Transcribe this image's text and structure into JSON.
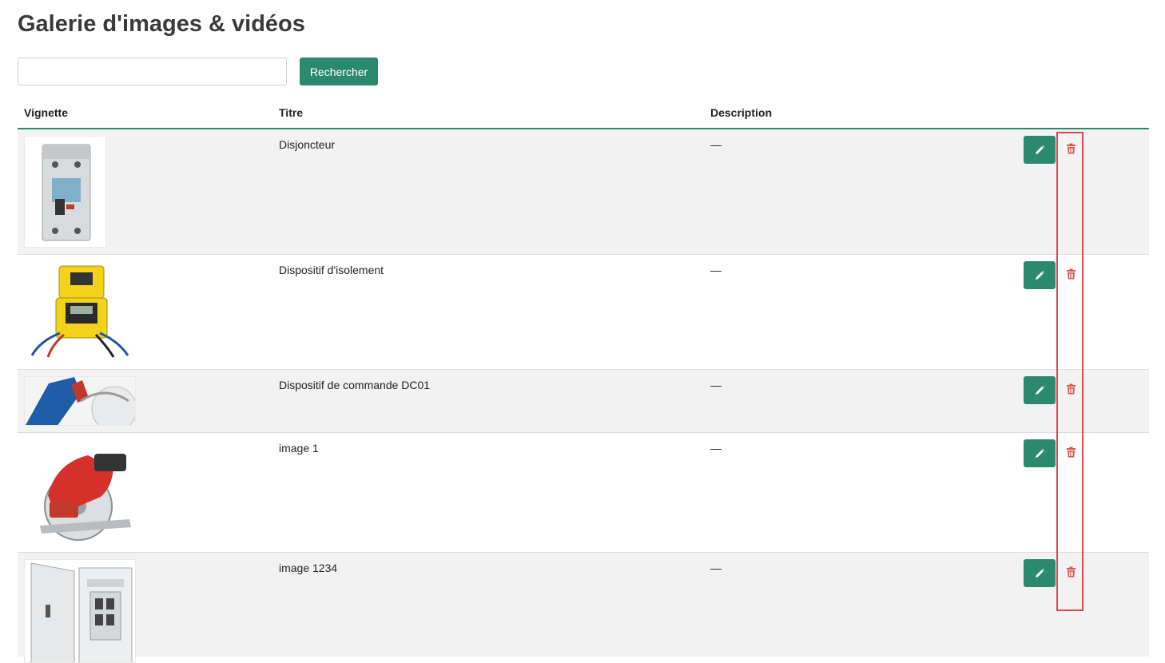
{
  "page": {
    "title": "Galerie d'images & vidéos"
  },
  "search": {
    "placeholder": "",
    "value": "",
    "button_label": "Rechercher"
  },
  "table": {
    "columns": [
      "Vignette",
      "Titre",
      "Description"
    ],
    "rows": [
      {
        "title": "Disjoncteur",
        "description": "—",
        "thumbnail_icon": "circuit-breaker-image"
      },
      {
        "title": "Dispositif d'isolement",
        "description": "—",
        "thumbnail_icon": "insulation-tester-image"
      },
      {
        "title": "Dispositif de commande DC01",
        "description": "—",
        "thumbnail_icon": "power-tool-image"
      },
      {
        "title": "image 1",
        "description": "—",
        "thumbnail_icon": "circular-saw-image"
      },
      {
        "title": "image 1234",
        "description": "—",
        "thumbnail_icon": "electrical-panel-image"
      }
    ]
  },
  "icons": {
    "edit": "pencil-icon",
    "delete": "trash-icon"
  },
  "colors": {
    "accent": "#2b8a6e",
    "delete": "#d9534f",
    "highlight": "#e0474c",
    "row_alt": "#f2f2f2"
  }
}
